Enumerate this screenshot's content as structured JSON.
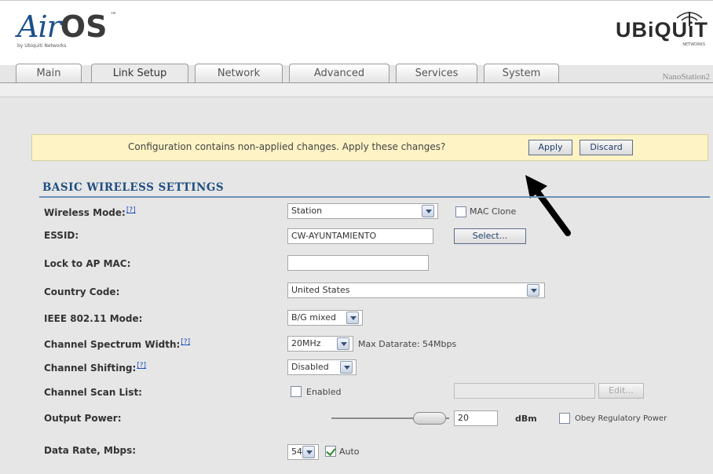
{
  "header": {
    "logo_air": "Air",
    "logo_os": "OS",
    "logo_tm": "™",
    "logo_sub": "by Ubiquiti Networks",
    "brand": "UBiQUiT",
    "brand_sub": "NETWORKS",
    "device_name": "NanoStation2"
  },
  "tabs": [
    {
      "label": "Main",
      "active": false
    },
    {
      "label": "Link Setup",
      "active": true
    },
    {
      "label": "Network",
      "active": false
    },
    {
      "label": "Advanced",
      "active": false
    },
    {
      "label": "Services",
      "active": false
    },
    {
      "label": "System",
      "active": false
    }
  ],
  "notice": {
    "text": "Configuration contains non-applied changes. Apply these changes?",
    "apply_label": "Apply",
    "discard_label": "Discard"
  },
  "section": {
    "title": "BASIC WIRELESS SETTINGS"
  },
  "form": {
    "wireless_mode": {
      "label": "Wireless Mode:",
      "help": "[?]",
      "value": "Station",
      "mac_clone_label": "MAC Clone",
      "mac_clone_checked": false
    },
    "essid": {
      "label": "ESSID:",
      "value": "CW-AYUNTAMIENTO",
      "select_label": "Select..."
    },
    "lock_ap_mac": {
      "label": "Lock to AP MAC:",
      "value": ""
    },
    "country_code": {
      "label": "Country Code:",
      "value": "United States"
    },
    "ieee_mode": {
      "label": "IEEE 802.11 Mode:",
      "value": "B/G mixed"
    },
    "channel_width": {
      "label": "Channel Spectrum Width:",
      "help": "[?]",
      "value": "20MHz",
      "max_rate": "Max Datarate: 54Mbps"
    },
    "channel_shifting": {
      "label": "Channel Shifting:",
      "help": "[?]",
      "value": "Disabled"
    },
    "scan_list": {
      "label": "Channel Scan List:",
      "enabled_label": "Enabled",
      "enabled_checked": false,
      "edit_label": "Edit..."
    },
    "output_power": {
      "label": "Output Power:",
      "value": "20",
      "unit": "dBm",
      "obey_label": "Obey Regulatory Power",
      "obey_checked": false
    },
    "data_rate": {
      "label": "Data Rate, Mbps:",
      "value": "54",
      "auto_label": "Auto",
      "auto_checked": true
    }
  },
  "colors": {
    "accent": "#1f4d82",
    "notice_bg": "#fdf3c5",
    "arrow": "#000000"
  }
}
